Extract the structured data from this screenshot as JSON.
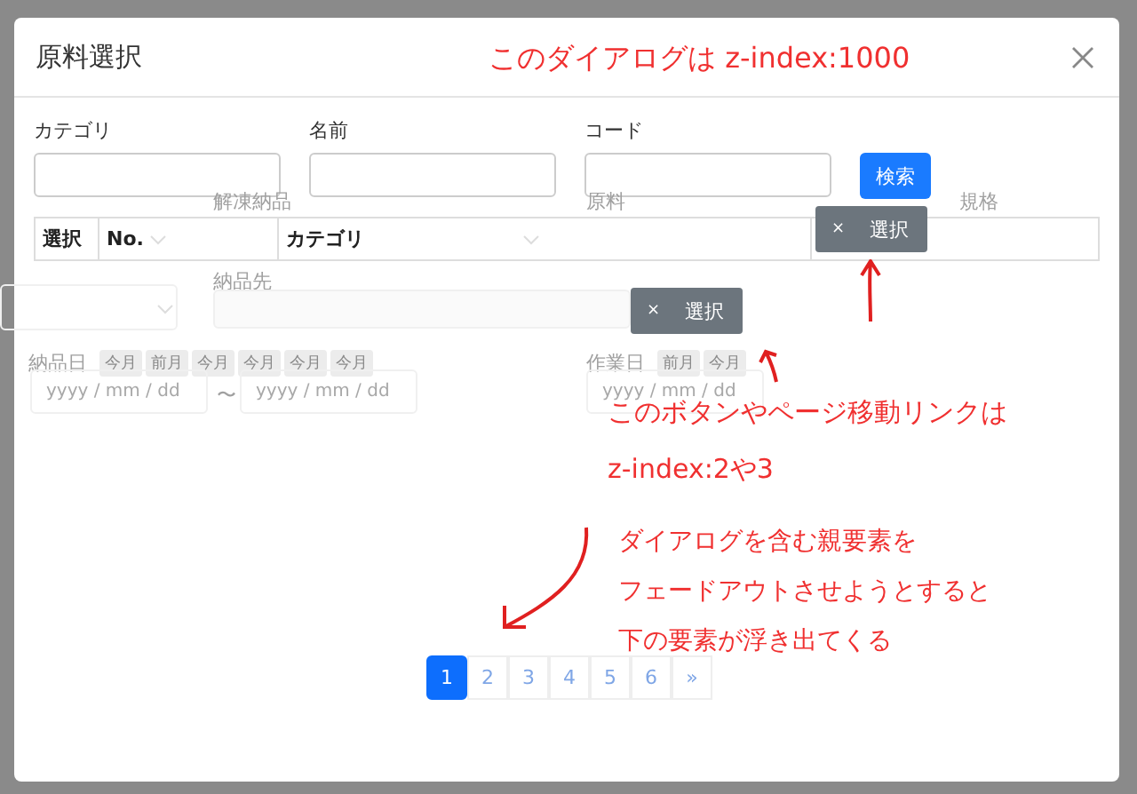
{
  "dialog": {
    "title": "原料選択"
  },
  "search_form": {
    "fields": [
      {
        "label": "カテゴリ"
      },
      {
        "label": "名前"
      },
      {
        "label": "コード"
      }
    ],
    "button": "検索"
  },
  "table": {
    "columns": [
      "選択",
      "No.",
      "カテゴリ"
    ]
  },
  "background_form": {
    "field_labels": [
      "解凍納品",
      "原料",
      "規格",
      "納品先"
    ],
    "delivery_date": {
      "label": "納品日",
      "tags": [
        "今月",
        "前月",
        "今月",
        "今月",
        "今月",
        "今月"
      ],
      "from_placeholder": "yyyy / mm / dd",
      "separator": "〜",
      "to_placeholder": "yyyy / mm / dd"
    },
    "work_date": {
      "label": "作業日",
      "tags": [
        "前月",
        "今月"
      ],
      "placeholder": "yyyy / mm / dd"
    }
  },
  "floating_buttons": [
    {
      "close": "×",
      "label": "選択"
    },
    {
      "close": "×",
      "label": "選択"
    }
  ],
  "pagination": [
    {
      "label": "1",
      "selected": true
    },
    {
      "label": "2",
      "selected": false
    },
    {
      "label": "3",
      "selected": false
    },
    {
      "label": "4",
      "selected": false
    },
    {
      "label": "5",
      "selected": false
    },
    {
      "label": "6",
      "selected": false
    },
    {
      "label": "»",
      "selected": false
    }
  ],
  "annotations": [
    {
      "lines": [
        "このダイアログは z-index:1000"
      ]
    },
    {
      "lines": [
        "このボタンやページ移動リンクは",
        "z-index:2や3"
      ]
    },
    {
      "lines": [
        "ダイアログを含む親要素を",
        "フェードアウトさせようとすると",
        "下の要素が浮き出てくる"
      ]
    }
  ]
}
